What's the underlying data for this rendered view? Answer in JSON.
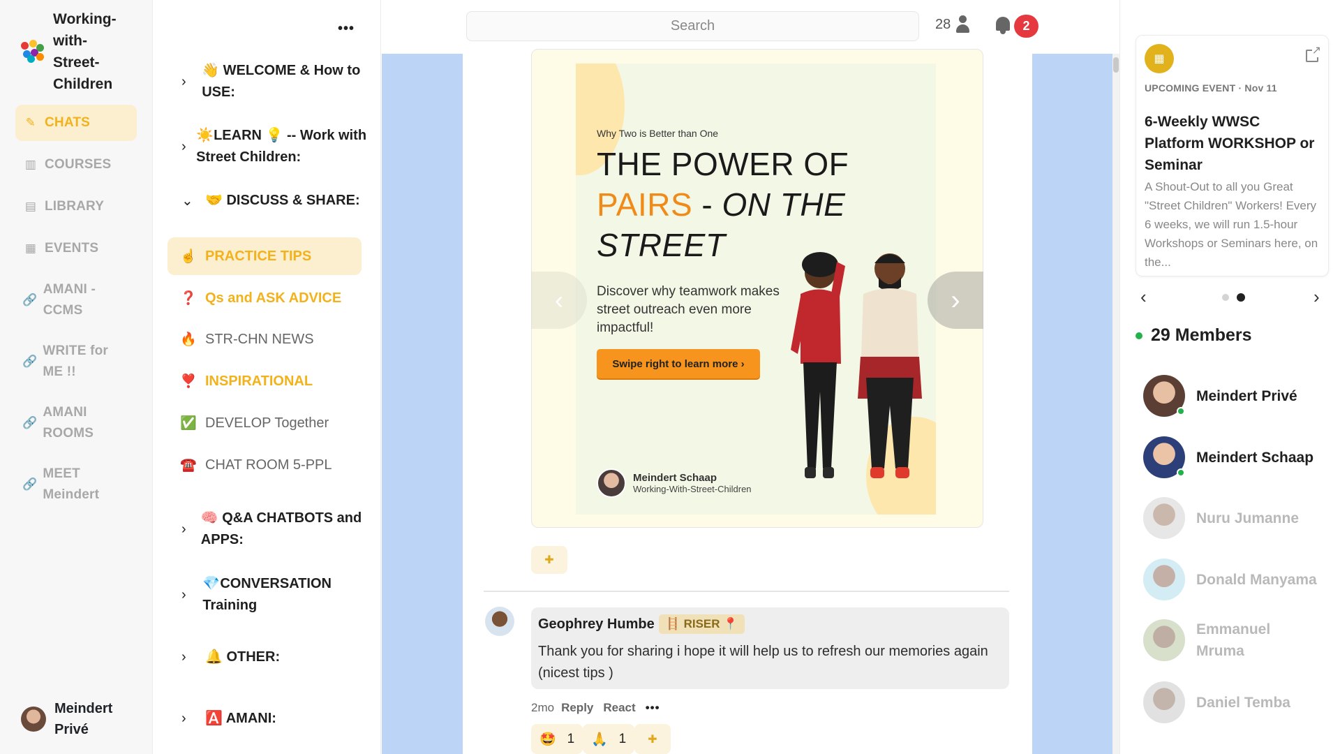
{
  "workspace": {
    "name": "Working-with-Street-Children"
  },
  "leftnav": {
    "items": [
      {
        "label": "CHATS",
        "icon": "pencil-icon",
        "active": true
      },
      {
        "label": "COURSES",
        "icon": "book-icon",
        "active": false
      },
      {
        "label": "LIBRARY",
        "icon": "document-icon",
        "active": false
      },
      {
        "label": "EVENTS",
        "icon": "calendar-icon",
        "active": false
      },
      {
        "label": "AMANI - CCMS",
        "icon": "link-icon",
        "active": false
      },
      {
        "label": "WRITE for ME !!",
        "icon": "link-icon",
        "active": false
      },
      {
        "label": "AMANI ROOMS",
        "icon": "link-icon",
        "active": false
      },
      {
        "label": "MEET Meindert",
        "icon": "link-icon",
        "active": false
      }
    ],
    "profile_name": "Meindert Privé"
  },
  "channels": {
    "more_label": "•••",
    "categories": [
      {
        "label": "WELCOME & How to USE:",
        "emoji": "👋",
        "expanded": false
      },
      {
        "label": "LEARN 💡 -- Work with Street Children:",
        "emoji": "☀️",
        "expanded": false
      },
      {
        "label": "DISCUSS & SHARE:",
        "emoji": "🤝",
        "expanded": true
      },
      {
        "label": "Q&A CHATBOTS and APPS:",
        "emoji": "🧠",
        "expanded": false
      },
      {
        "label": "CONVERSATION Training",
        "emoji": "💎",
        "expanded": false
      },
      {
        "label": "OTHER:",
        "emoji": "🔔",
        "expanded": false
      },
      {
        "label": "AMANI:",
        "emoji": "🅰️",
        "expanded": false
      }
    ],
    "items": [
      {
        "label": "PRACTICE TIPS",
        "emoji": "☝️",
        "active": true,
        "highlight": true
      },
      {
        "label": "Qs and ASK ADVICE",
        "emoji": "❓",
        "active": false,
        "highlight": true
      },
      {
        "label": "STR-CHN NEWS",
        "emoji": "🔥",
        "active": false,
        "highlight": false
      },
      {
        "label": "INSPIRATIONAL",
        "emoji": "❣️",
        "active": false,
        "highlight": true
      },
      {
        "label": "DEVELOP Together",
        "emoji": "✅",
        "active": false,
        "highlight": false
      },
      {
        "label": "CHAT ROOM 5-PPL",
        "emoji": "☎️",
        "active": false,
        "highlight": false
      }
    ]
  },
  "topbar": {
    "search_placeholder": "Search",
    "online_count": "28",
    "notification_count": "2"
  },
  "post": {
    "poster": {
      "eyebrow": "Why Two is Better than One",
      "headline_line1": "THE POWER OF",
      "headline_orange": "PAIRS",
      "headline_dash": " - ",
      "headline_ital1": "ON THE",
      "headline_ital2": "STREET",
      "description": "Discover why teamwork makes street outreach even more impactful!",
      "cta": "Swipe right to learn more ›",
      "author_name": "Meindert Schaap",
      "author_org": "Working-With-Street-Children"
    }
  },
  "comment": {
    "author": "Geophrey Humbe",
    "badge": "🪜 RISER 📍",
    "text": "Thank you for sharing i hope it will help us to refresh our memories again (nicest tips )",
    "age": "2mo",
    "reply_label": "Reply",
    "react_label": "React",
    "more_label": "•••",
    "reactions": [
      {
        "emoji": "🤩",
        "count": "1"
      },
      {
        "emoji": "🙏",
        "count": "1"
      }
    ]
  },
  "event": {
    "kicker": "UPCOMING EVENT · Nov 11",
    "title": "6-Weekly WWSC Platform WORKSHOP or Seminar",
    "description": "A Shout-Out to all you Great \"Street Children\" Workers! Every 6 weeks, we will run 1.5-hour Workshops or Seminars here, on the..."
  },
  "members": {
    "title": "29 Members",
    "list": [
      {
        "name": "Meindert Privé",
        "online": true
      },
      {
        "name": "Meindert Schaap",
        "online": true
      },
      {
        "name": "Nuru Jumanne",
        "online": false
      },
      {
        "name": "Donald Manyama",
        "online": false
      },
      {
        "name": "Emmanuel Mruma",
        "online": false
      },
      {
        "name": "Daniel Temba",
        "online": false
      }
    ]
  },
  "colors": {
    "accent": "#f2b21b",
    "active_bg": "#fbefcf",
    "side_stripe": "#bcd4f5",
    "badge_red": "#e5393f",
    "online_green": "#22b14c",
    "poster_orange": "#f08a18"
  }
}
